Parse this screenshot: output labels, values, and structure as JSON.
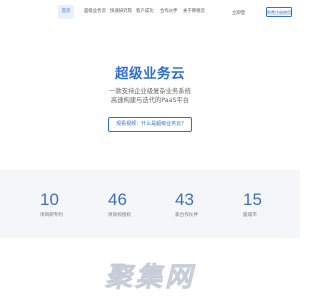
{
  "nav": {
    "items": [
      {
        "label": "首页",
        "active": true
      },
      {
        "label": "超级业务云",
        "active": false
      },
      {
        "label": "快速研究院",
        "active": false
      },
      {
        "label": "客户成功",
        "active": false
      },
      {
        "label": "合作伙伴",
        "active": false
      },
      {
        "label": "关于降德云",
        "active": false
      }
    ],
    "login": "立即登",
    "register": "免费注册使用"
  },
  "hero": {
    "title": "超级业务云",
    "subtitle_line1": "一款支持企业级复杂业务系统",
    "subtitle_line2": "高速构建与迭代的PaaS平台",
    "cta": "观看视频：什么是超级业务云?"
  },
  "stats": [
    {
      "value": "10",
      "label": "项目研专利"
    },
    {
      "value": "46",
      "label": "项商标授权"
    },
    {
      "value": "43",
      "label": "家合作伙伴"
    },
    {
      "value": "15",
      "label": "座城市"
    }
  ],
  "watermark": {
    "text": "聚集网"
  },
  "colors": {
    "brand": "#2d6fd8",
    "stat": "#3d6fbd",
    "stats_bg": "#f5f6f9",
    "watermark_fill": "#d9dee6"
  }
}
